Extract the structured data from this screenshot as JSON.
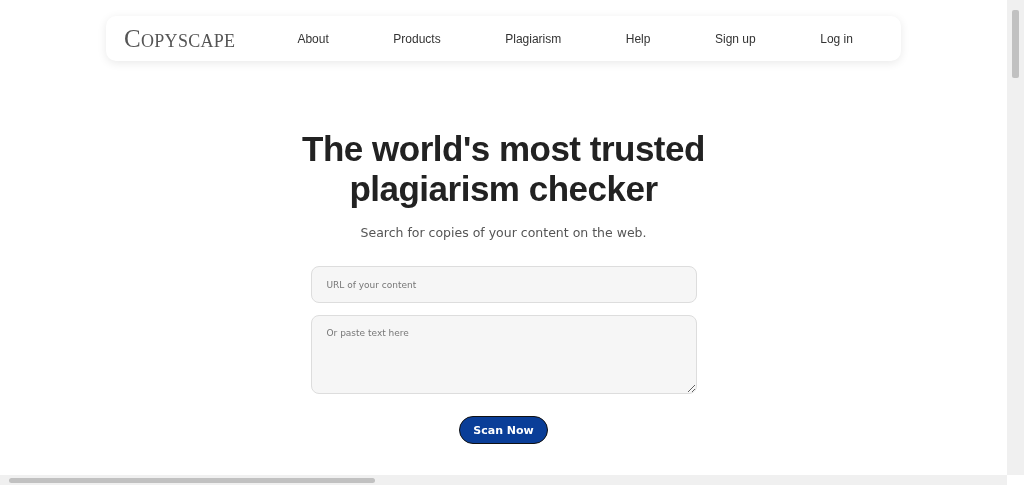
{
  "header": {
    "logo": "Copyscape",
    "nav": [
      {
        "label": "About"
      },
      {
        "label": "Products"
      },
      {
        "label": "Plagiarism"
      },
      {
        "label": "Help"
      },
      {
        "label": "Sign up"
      },
      {
        "label": "Log in"
      }
    ]
  },
  "hero": {
    "title_lines": [
      "The world's most trusted",
      "plagiarism checker"
    ],
    "subtitle": "Search for copies of your content on the web."
  },
  "form": {
    "url_field": {
      "placeholder": "URL of your content"
    },
    "text_field": {
      "placeholder": "Or paste text here"
    },
    "button": "Scan Now"
  }
}
